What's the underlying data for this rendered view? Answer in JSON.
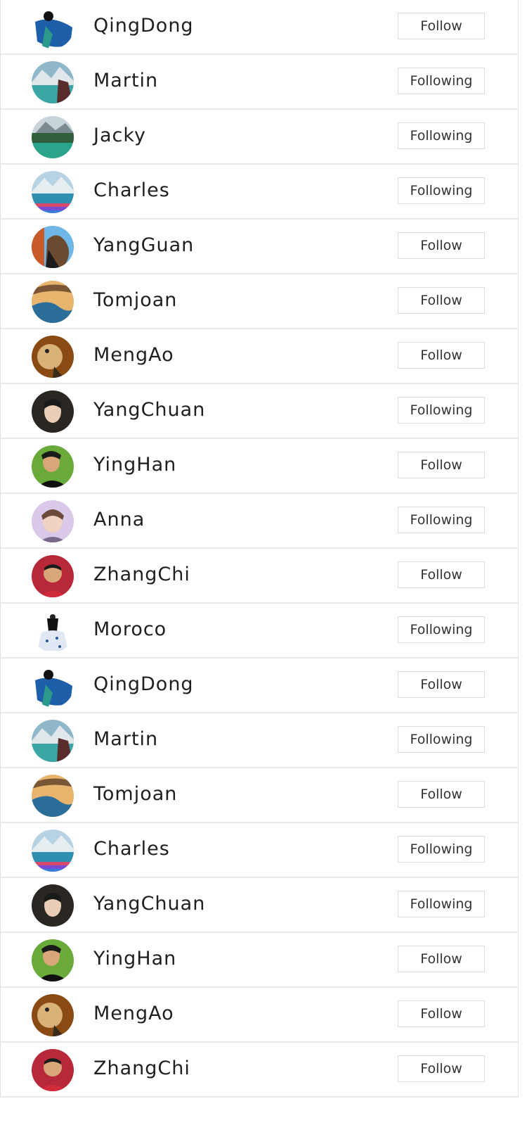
{
  "users": [
    {
      "name": "QingDong",
      "button": "Follow",
      "avatar": "avatar-fashion-blue"
    },
    {
      "name": "Martin",
      "button": "Following",
      "avatar": "avatar-lake-mountain"
    },
    {
      "name": "Jacky",
      "button": "Following",
      "avatar": "avatar-forest-lake"
    },
    {
      "name": "Charles",
      "button": "Following",
      "avatar": "avatar-mountain-boats"
    },
    {
      "name": "YangGuan",
      "button": "Follow",
      "avatar": "avatar-bridge-portrait"
    },
    {
      "name": "Tomjoan",
      "button": "Follow",
      "avatar": "avatar-desert-landscape"
    },
    {
      "name": "MengAo",
      "button": "Follow",
      "avatar": "avatar-bird"
    },
    {
      "name": "YangChuan",
      "button": "Following",
      "avatar": "avatar-woman-portrait"
    },
    {
      "name": "YingHan",
      "button": "Follow",
      "avatar": "avatar-man-portrait"
    },
    {
      "name": "Anna",
      "button": "Following",
      "avatar": "avatar-girl-portrait"
    },
    {
      "name": "ZhangChi",
      "button": "Follow",
      "avatar": "avatar-boy-crowd"
    },
    {
      "name": "Moroco",
      "button": "Following",
      "avatar": "avatar-fashion-dress"
    },
    {
      "name": "QingDong",
      "button": "Follow",
      "avatar": "avatar-fashion-blue"
    },
    {
      "name": "Martin",
      "button": "Following",
      "avatar": "avatar-lake-mountain"
    },
    {
      "name": "Tomjoan",
      "button": "Follow",
      "avatar": "avatar-desert-landscape"
    },
    {
      "name": "Charles",
      "button": "Following",
      "avatar": "avatar-mountain-boats"
    },
    {
      "name": "YangChuan",
      "button": "Following",
      "avatar": "avatar-woman-portrait"
    },
    {
      "name": "YingHan",
      "button": "Follow",
      "avatar": "avatar-man-portrait"
    },
    {
      "name": "MengAo",
      "button": "Follow",
      "avatar": "avatar-bird"
    },
    {
      "name": "ZhangChi",
      "button": "Follow",
      "avatar": "avatar-boy-crowd"
    }
  ],
  "colors": {
    "border": "#e2e2e2",
    "text": "#1f1f1f",
    "button_border": "#dcdcdc"
  }
}
